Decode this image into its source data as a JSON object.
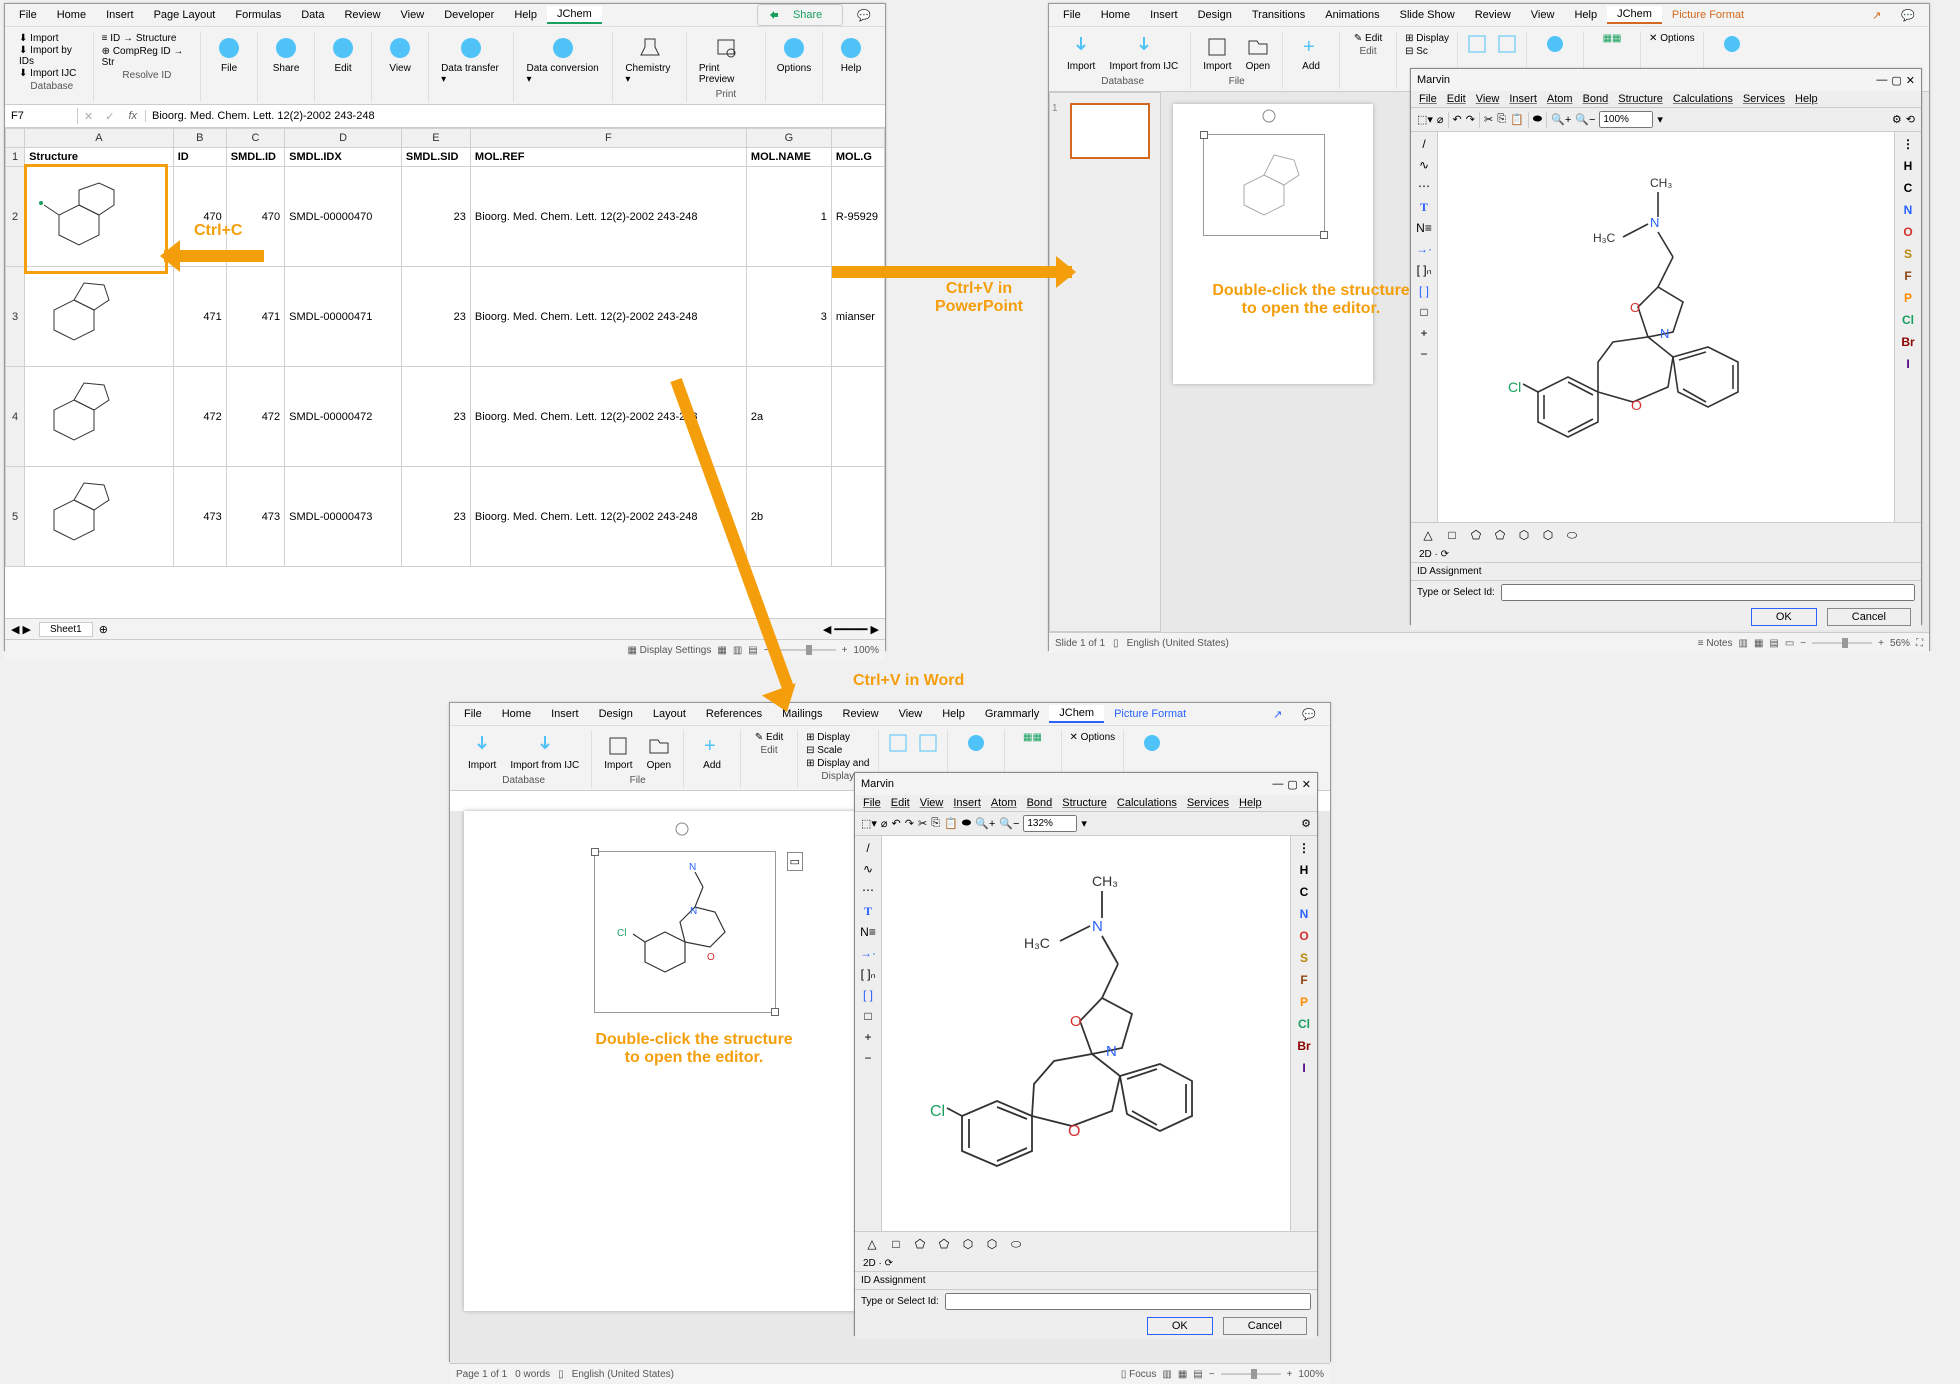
{
  "excel": {
    "menus": [
      "File",
      "Home",
      "Insert",
      "Page Layout",
      "Formulas",
      "Data",
      "Review",
      "View",
      "Developer",
      "Help",
      "JChem"
    ],
    "share": "Share",
    "db_group": [
      "Import",
      "Import by IDs",
      "Import IJC"
    ],
    "db_label": "Database",
    "resolve_items": [
      "ID → Structure",
      "CompReg ID → Str"
    ],
    "resolve_label": "Resolve ID",
    "ribbon_btns": [
      "File",
      "Share",
      "Edit",
      "View",
      "Data transfer ▾",
      "Data conversion ▾",
      "Chemistry ▾",
      "Print Preview",
      "Options",
      "Help"
    ],
    "print_label": "Print",
    "cell_ref": "F7",
    "formula": "Bioorg. Med. Chem. Lett. 12(2)-2002 243-248",
    "cols": [
      "",
      "A",
      "B",
      "C",
      "D",
      "E",
      "F",
      "G",
      ""
    ],
    "headers": [
      "Structure",
      "ID",
      "SMDL.ID",
      "SMDL.IDX",
      "SMDL.SID",
      "MOL.REF",
      "MOL.NAME",
      "MOL.G"
    ],
    "rows": [
      {
        "r": "2",
        "id": "470",
        "sid": "470",
        "idx": "SMDL-00000470",
        "ssid": "23",
        "ref": "Bioorg. Med. Chem. Lett. 12(2)-2002 243-248",
        "name": "1",
        "g": "R-95929"
      },
      {
        "r": "3",
        "id": "471",
        "sid": "471",
        "idx": "SMDL-00000471",
        "ssid": "23",
        "ref": "Bioorg. Med. Chem. Lett. 12(2)-2002 243-248",
        "name": "3",
        "g": "mianser"
      },
      {
        "r": "4",
        "id": "472",
        "sid": "472",
        "idx": "SMDL-00000472",
        "ssid": "23",
        "ref": "Bioorg. Med. Chem. Lett. 12(2)-2002 243-248",
        "name": "2a",
        "g": ""
      },
      {
        "r": "5",
        "id": "473",
        "sid": "473",
        "idx": "SMDL-00000473",
        "ssid": "23",
        "ref": "Bioorg. Med. Chem. Lett. 12(2)-2002 243-248",
        "name": "2b",
        "g": ""
      }
    ],
    "sheet_tab": "Sheet1",
    "display_settings": "Display Settings",
    "zoom": "100%"
  },
  "ppt": {
    "menus": [
      "File",
      "Home",
      "Insert",
      "Design",
      "Transitions",
      "Animations",
      "Slide Show",
      "Review",
      "View",
      "Help",
      "JChem",
      "Picture Format"
    ],
    "db_label": "Database",
    "file_label": "File",
    "edit_label": "Edit",
    "import": "Import",
    "import_ijc": "Import from IJC",
    "importf": "Import",
    "open": "Open",
    "add": "Add",
    "editbtn": "Edit",
    "display": "Display",
    "scale": "Scale",
    "options": "Options",
    "status_slide": "Slide 1 of 1",
    "status_lang": "English (United States)",
    "notes": "Notes",
    "zoom": "56%"
  },
  "word": {
    "menus": [
      "File",
      "Home",
      "Insert",
      "Design",
      "Layout",
      "References",
      "Mailings",
      "Review",
      "View",
      "Help",
      "Grammarly",
      "JChem",
      "Picture Format"
    ],
    "db_label": "Database",
    "file_label": "File",
    "edit_label": "Edit",
    "display_label": "Display",
    "import": "Import",
    "import_ijc": "Import from IJC",
    "importf": "Import",
    "open": "Open",
    "add": "Add",
    "editbtn": "Edit",
    "display": "Display",
    "scale": "Scale",
    "display_and": "Display and",
    "options": "Options",
    "status_page": "Page 1 of 1",
    "status_words": "0 words",
    "status_lang": "English (United States)",
    "focus": "Focus",
    "zoom": "100%"
  },
  "marvin": {
    "title": "Marvin",
    "menus": [
      "File",
      "Edit",
      "View",
      "Insert",
      "Atom",
      "Bond",
      "Structure",
      "Calculations",
      "Services",
      "Help"
    ],
    "zoom_ppt": "100%",
    "zoom_word": "132%",
    "side": [
      "/",
      "∿",
      "⋯",
      "T",
      "N≡",
      "→·",
      "[ ]ₙ",
      "[ ]",
      "□",
      "+",
      "−"
    ],
    "elements_top": "⋮",
    "elements": [
      "H",
      "C",
      "N",
      "O",
      "S",
      "F",
      "P",
      "Cl",
      "Br",
      "I"
    ],
    "rings": [
      "△",
      "□",
      "⬠",
      "⬠",
      "⬡",
      "⬡",
      "⬭"
    ],
    "twod": "2D  ·  ⟳",
    "id_assign": "ID Assignment",
    "id_label": "Type or Select Id:",
    "ok": "OK",
    "cancel": "Cancel"
  },
  "annot": {
    "copy": "Ctrl+C",
    "paste_ppt": "Ctrl+V in PowerPoint",
    "paste_word": "Ctrl+V in Word",
    "dbl_ppt": "Double-click the structure to open the editor.",
    "dbl_word": "Double-click the structure to open the editor."
  }
}
